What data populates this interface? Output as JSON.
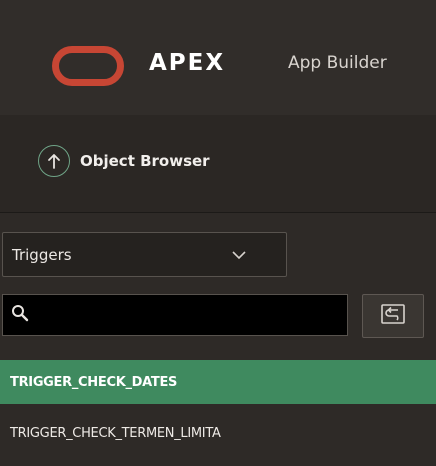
{
  "header": {
    "brand": "APEX",
    "nav_item": "App Builder"
  },
  "toolbar": {
    "object_browser_label": "Object Browser"
  },
  "object_type_select": {
    "selected": "Triggers"
  },
  "search": {
    "value": "",
    "placeholder": ""
  },
  "object_list": [
    {
      "name": "TRIGGER_CHECK_DATES",
      "selected": true
    },
    {
      "name": "TRIGGER_CHECK_TERMEN_LIMITA",
      "selected": false
    }
  ],
  "colors": {
    "header_bg": "#312d2a",
    "logo_red": "#c74634",
    "selected_green": "#3f8a5f",
    "panel_bg": "#2e2a27"
  },
  "icons": {
    "logo": "oracle-logo-icon",
    "object_browser": "arrow-up-circle-icon",
    "select_caret": "chevron-down-icon",
    "search": "search-icon",
    "refresh": "refresh-icon"
  }
}
